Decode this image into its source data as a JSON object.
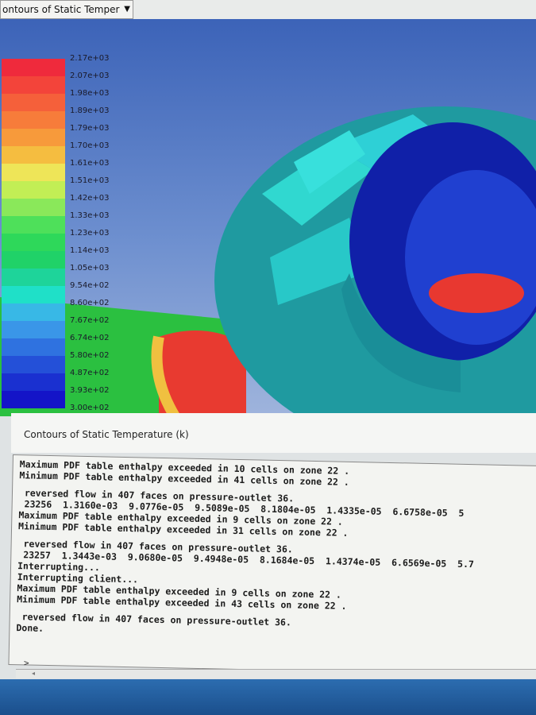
{
  "dropdown": {
    "value": "ontours of Static Temper",
    "icon": "chevron-down-icon"
  },
  "legend": {
    "labels": [
      "2.17e+03",
      "2.07e+03",
      "1.98e+03",
      "1.89e+03",
      "1.79e+03",
      "1.70e+03",
      "1.61e+03",
      "1.51e+03",
      "1.42e+03",
      "1.33e+03",
      "1.23e+03",
      "1.14e+03",
      "1.05e+03",
      "9.54e+02",
      "8.60e+02",
      "7.67e+02",
      "6.74e+02",
      "5.80e+02",
      "4.87e+02",
      "3.93e+02",
      "3.00e+02"
    ],
    "colors": [
      "#ef2a3c",
      "#f3443a",
      "#f5603a",
      "#f77c3a",
      "#f79a3b",
      "#f5bd40",
      "#eee558",
      "#c2ee55",
      "#8ae85a",
      "#4ee05a",
      "#2ed85a",
      "#20d268",
      "#1ed49a",
      "#1fe0c8",
      "#38b8e6",
      "#3a96e8",
      "#2f72e0",
      "#2450d8",
      "#1a30d0",
      "#1414c8"
    ]
  },
  "caption": "Contours of Static Temperature (k)",
  "console": {
    "lines": [
      "Maximum PDF table enthalpy exceeded in 10 cells on zone 22 .",
      "Minimum PDF table enthalpy exceeded in 41 cells on zone 22 .",
      "",
      " reversed flow in 407 faces on pressure-outlet 36.",
      " 23256  1.3160e-03  9.0776e-05  9.5089e-05  8.1804e-05  1.4335e-05  6.6758e-05  5",
      "Maximum PDF table enthalpy exceeded in 9 cells on zone 22 .",
      "Minimum PDF table enthalpy exceeded in 31 cells on zone 22 .",
      "",
      " reversed flow in 407 faces on pressure-outlet 36.",
      " 23257  1.3443e-03  9.0680e-05  9.4948e-05  8.1684e-05  1.4374e-05  6.6569e-05  5.7",
      "Interrupting...",
      "Interrupting client...",
      "Maximum PDF table enthalpy exceeded in 9 cells on zone 22 .",
      "Minimum PDF table enthalpy exceeded in 43 cells on zone 22 .",
      "",
      " reversed flow in 407 faces on pressure-outlet 36.",
      "Done."
    ],
    "prompt": ">"
  }
}
